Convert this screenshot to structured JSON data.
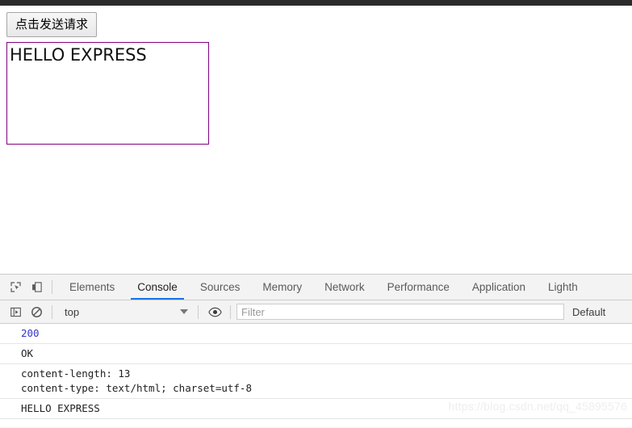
{
  "page": {
    "button_label": "点击发送请求",
    "result_text": "HELLO EXPRESS"
  },
  "devtools": {
    "icons": {
      "inspect": "inspect-element-icon",
      "device": "device-toolbar-icon",
      "sidebar": "console-sidebar-icon",
      "clear": "clear-console-icon",
      "eye": "live-expression-eye-icon"
    },
    "tabs": [
      {
        "label": "Elements",
        "active": false
      },
      {
        "label": "Console",
        "active": true
      },
      {
        "label": "Sources",
        "active": false
      },
      {
        "label": "Memory",
        "active": false
      },
      {
        "label": "Network",
        "active": false
      },
      {
        "label": "Performance",
        "active": false
      },
      {
        "label": "Application",
        "active": false
      },
      {
        "label": "Lighth",
        "active": false
      }
    ],
    "console_toolbar": {
      "context_value": "top",
      "filter_placeholder": "Filter",
      "filter_value": "",
      "level_value": "Default"
    },
    "messages": [
      {
        "text": "200",
        "style": "num"
      },
      {
        "text": "OK",
        "style": "plain"
      },
      {
        "text": "content-length: 13\ncontent-type: text/html; charset=utf-8",
        "style": "plain"
      },
      {
        "text": "HELLO EXPRESS",
        "style": "plain"
      }
    ]
  },
  "watermark": {
    "text": "https://blog.csdn.net/qq_45895576"
  },
  "colors": {
    "accent": "#1a73e8",
    "box_border": "#800080",
    "number": "#3333cc",
    "chrome": "#2b2b2b"
  }
}
